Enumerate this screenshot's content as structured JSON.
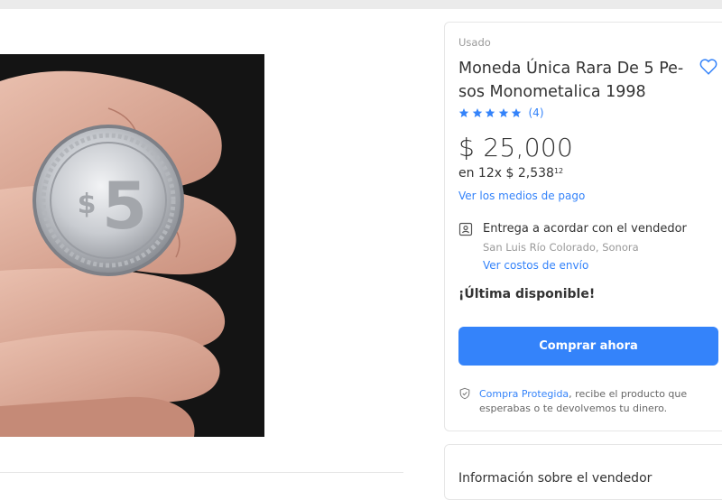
{
  "listing": {
    "condition": "Usado",
    "title": "Moneda Única Rara De 5 Pe-sos Monometalica 1998",
    "rating": {
      "stars": 5,
      "reviews": "(4)"
    },
    "price": "$ 25,000",
    "installments": {
      "prefix": "en 12x $ 2,538",
      "cents": "12"
    },
    "payment_link": "Ver los medios de pago",
    "delivery": {
      "title": "Entrega a acordar con el vendedor",
      "location": "San Luis Río Colorado, Sonora",
      "shipping_link": "Ver costos de envío"
    },
    "stock": "¡Última disponible!",
    "buy_button": "Comprar ahora",
    "protection": {
      "link": "Compra Protegida",
      "text": ", recibe el producto que esperabas o te devolvemos tu dinero."
    },
    "seller_section": "Información sobre el vendedor"
  },
  "colors": {
    "accent": "#3483fa",
    "text": "#333333",
    "muted": "#999999"
  },
  "photo": {
    "coin_value": "5"
  }
}
